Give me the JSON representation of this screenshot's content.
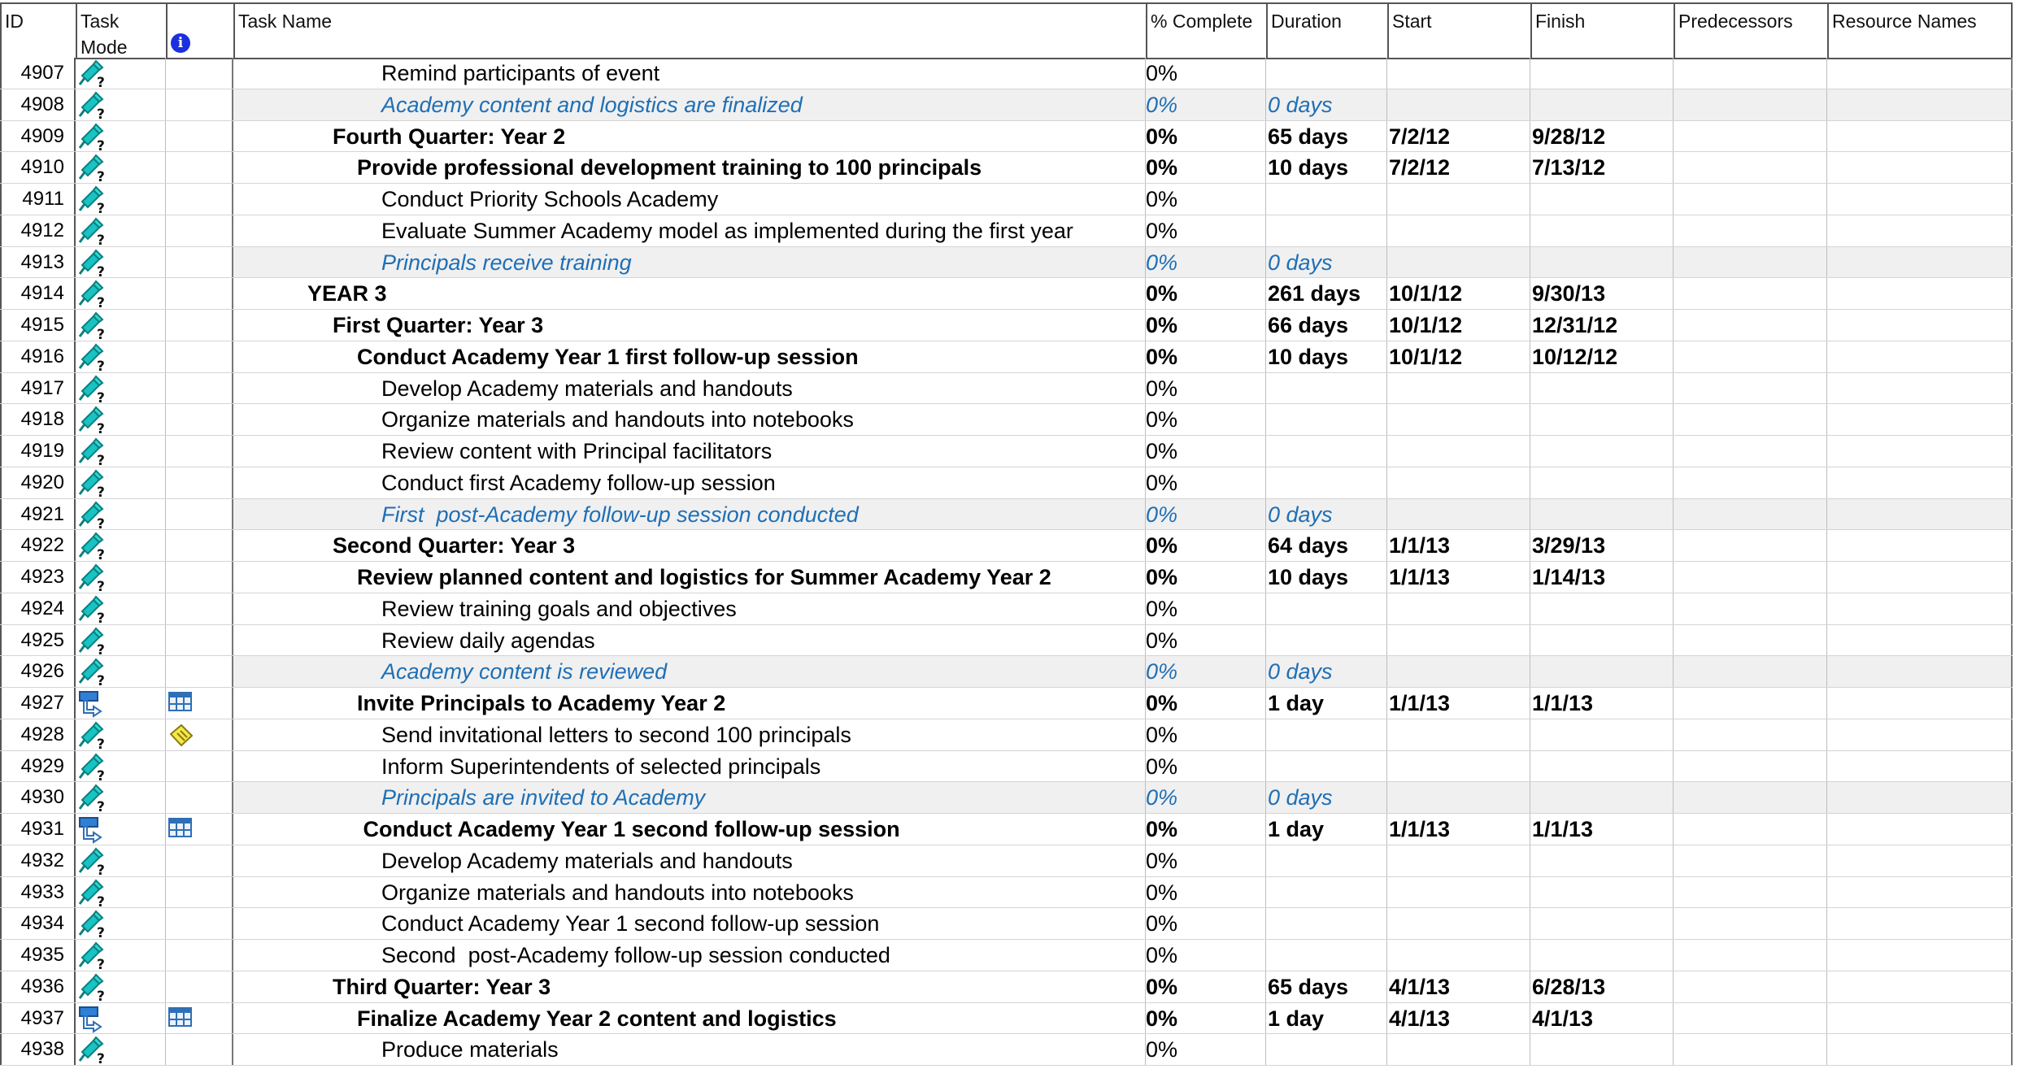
{
  "columns": {
    "id": "ID",
    "mode": "Task\nMode",
    "indicator_icon": "info-icon",
    "name": "Task Name",
    "pct": "% Complete",
    "duration": "Duration",
    "start": "Start",
    "finish": "Finish",
    "predecessors": "Predecessors",
    "resources": "Resource Names"
  },
  "colors": {
    "milestone_text": "#1f6fb5",
    "milestone_bg": "#f0f0f0",
    "grid": "#555555"
  },
  "rows": [
    {
      "id": "4907",
      "mode": "manual",
      "indicator": "",
      "level": 3,
      "style": "normal",
      "name": "Remind participants of event",
      "pct": "0%",
      "duration": "",
      "start": "",
      "finish": ""
    },
    {
      "id": "4908",
      "mode": "manual",
      "indicator": "",
      "level": 3,
      "style": "milestone",
      "name": "Academy content and logistics are finalized",
      "pct": "0%",
      "duration": "0 days",
      "start": "",
      "finish": ""
    },
    {
      "id": "4909",
      "mode": "manual",
      "indicator": "",
      "level": 1,
      "style": "bold",
      "name": "Fourth Quarter: Year 2",
      "pct": "0%",
      "duration": "65 days",
      "start": "7/2/12",
      "finish": "9/28/12"
    },
    {
      "id": "4910",
      "mode": "manual",
      "indicator": "",
      "level": 2,
      "style": "bold",
      "name": "Provide professional development training to 100 principals",
      "pct": "0%",
      "duration": "10 days",
      "start": "7/2/12",
      "finish": "7/13/12"
    },
    {
      "id": "4911",
      "mode": "manual",
      "indicator": "",
      "level": 3,
      "style": "normal",
      "name": "Conduct Priority Schools Academy",
      "pct": "0%",
      "duration": "",
      "start": "",
      "finish": ""
    },
    {
      "id": "4912",
      "mode": "manual",
      "indicator": "",
      "level": 3,
      "style": "normal",
      "name": "Evaluate Summer Academy model as implemented during the first year",
      "pct": "0%",
      "duration": "",
      "start": "",
      "finish": ""
    },
    {
      "id": "4913",
      "mode": "manual",
      "indicator": "",
      "level": 3,
      "style": "milestone",
      "name": "Principals receive training",
      "pct": "0%",
      "duration": "0 days",
      "start": "",
      "finish": ""
    },
    {
      "id": "4914",
      "mode": "manual",
      "indicator": "",
      "level": 0,
      "style": "bold",
      "name": "YEAR 3",
      "pct": "0%",
      "duration": "261 days",
      "start": "10/1/12",
      "finish": "9/30/13"
    },
    {
      "id": "4915",
      "mode": "manual",
      "indicator": "",
      "level": 1,
      "style": "bold",
      "name": "First Quarter: Year 3",
      "pct": "0%",
      "duration": "66 days",
      "start": "10/1/12",
      "finish": "12/31/12"
    },
    {
      "id": "4916",
      "mode": "manual",
      "indicator": "",
      "level": 2,
      "style": "bold",
      "name": "Conduct Academy Year 1 first follow-up session",
      "pct": "0%",
      "duration": "10 days",
      "start": "10/1/12",
      "finish": "10/12/12"
    },
    {
      "id": "4917",
      "mode": "manual",
      "indicator": "",
      "level": 3,
      "style": "normal",
      "name": "Develop Academy materials and handouts",
      "pct": "0%",
      "duration": "",
      "start": "",
      "finish": ""
    },
    {
      "id": "4918",
      "mode": "manual",
      "indicator": "",
      "level": 3,
      "style": "normal",
      "name": "Organize materials and handouts into notebooks",
      "pct": "0%",
      "duration": "",
      "start": "",
      "finish": ""
    },
    {
      "id": "4919",
      "mode": "manual",
      "indicator": "",
      "level": 3,
      "style": "normal",
      "name": "Review content with Principal facilitators",
      "pct": "0%",
      "duration": "",
      "start": "",
      "finish": ""
    },
    {
      "id": "4920",
      "mode": "manual",
      "indicator": "",
      "level": 3,
      "style": "normal",
      "name": "Conduct first Academy follow-up session",
      "pct": "0%",
      "duration": "",
      "start": "",
      "finish": ""
    },
    {
      "id": "4921",
      "mode": "manual",
      "indicator": "",
      "level": 3,
      "style": "milestone",
      "name": "First  post-Academy follow-up session conducted",
      "pct": "0%",
      "duration": "0 days",
      "start": "",
      "finish": ""
    },
    {
      "id": "4922",
      "mode": "manual",
      "indicator": "",
      "level": 1,
      "style": "bold",
      "name": "Second Quarter: Year 3",
      "pct": "0%",
      "duration": "64 days",
      "start": "1/1/13",
      "finish": "3/29/13"
    },
    {
      "id": "4923",
      "mode": "manual",
      "indicator": "",
      "level": 2,
      "style": "bold",
      "name": "Review planned content and logistics for Summer Academy Year 2",
      "pct": "0%",
      "duration": "10 days",
      "start": "1/1/13",
      "finish": "1/14/13"
    },
    {
      "id": "4924",
      "mode": "manual",
      "indicator": "",
      "level": 3,
      "style": "normal",
      "name": "Review training goals and objectives",
      "pct": "0%",
      "duration": "",
      "start": "",
      "finish": ""
    },
    {
      "id": "4925",
      "mode": "manual",
      "indicator": "",
      "level": 3,
      "style": "normal",
      "name": "Review daily agendas",
      "pct": "0%",
      "duration": "",
      "start": "",
      "finish": ""
    },
    {
      "id": "4926",
      "mode": "manual",
      "indicator": "",
      "level": 3,
      "style": "milestone",
      "name": "Academy content is reviewed",
      "pct": "0%",
      "duration": "0 days",
      "start": "",
      "finish": ""
    },
    {
      "id": "4927",
      "mode": "auto",
      "indicator": "calendar",
      "level": 2,
      "style": "bold",
      "name": "Invite Principals to Academy Year 2",
      "pct": "0%",
      "duration": "1 day",
      "start": "1/1/13",
      "finish": "1/1/13"
    },
    {
      "id": "4928",
      "mode": "manual",
      "indicator": "note",
      "level": 3,
      "style": "normal",
      "name": "Send invitational letters to second 100 principals",
      "pct": "0%",
      "duration": "",
      "start": "",
      "finish": ""
    },
    {
      "id": "4929",
      "mode": "manual",
      "indicator": "",
      "level": 3,
      "style": "normal",
      "name": "Inform Superintendents of selected principals",
      "pct": "0%",
      "duration": "",
      "start": "",
      "finish": ""
    },
    {
      "id": "4930",
      "mode": "manual",
      "indicator": "",
      "level": 3,
      "style": "milestone",
      "name": "Principals are invited to Academy",
      "pct": "0%",
      "duration": "0 days",
      "start": "",
      "finish": ""
    },
    {
      "id": "4931",
      "mode": "auto",
      "indicator": "calendar",
      "level": 2,
      "style": "bold",
      "name": " Conduct Academy Year 1 second follow-up session",
      "pct": "0%",
      "duration": "1 day",
      "start": "1/1/13",
      "finish": "1/1/13"
    },
    {
      "id": "4932",
      "mode": "manual",
      "indicator": "",
      "level": 3,
      "style": "normal",
      "name": "Develop Academy materials and handouts",
      "pct": "0%",
      "duration": "",
      "start": "",
      "finish": ""
    },
    {
      "id": "4933",
      "mode": "manual",
      "indicator": "",
      "level": 3,
      "style": "normal",
      "name": "Organize materials and handouts into notebooks",
      "pct": "0%",
      "duration": "",
      "start": "",
      "finish": ""
    },
    {
      "id": "4934",
      "mode": "manual",
      "indicator": "",
      "level": 3,
      "style": "normal",
      "name": "Conduct Academy Year 1 second follow-up session",
      "pct": "0%",
      "duration": "",
      "start": "",
      "finish": ""
    },
    {
      "id": "4935",
      "mode": "manual",
      "indicator": "",
      "level": 3,
      "style": "normal",
      "name": "Second  post-Academy follow-up session conducted",
      "pct": "0%",
      "duration": "",
      "start": "",
      "finish": ""
    },
    {
      "id": "4936",
      "mode": "manual",
      "indicator": "",
      "level": 1,
      "style": "bold",
      "name": "Third Quarter: Year 3",
      "pct": "0%",
      "duration": "65 days",
      "start": "4/1/13",
      "finish": "6/28/13"
    },
    {
      "id": "4937",
      "mode": "auto",
      "indicator": "calendar",
      "level": 2,
      "style": "bold",
      "name": "Finalize Academy Year 2 content and logistics",
      "pct": "0%",
      "duration": "1 day",
      "start": "4/1/13",
      "finish": "4/1/13"
    },
    {
      "id": "4938",
      "mode": "manual",
      "indicator": "",
      "level": 3,
      "style": "normal",
      "name": "Produce materials",
      "pct": "0%",
      "duration": "",
      "start": "",
      "finish": ""
    }
  ]
}
